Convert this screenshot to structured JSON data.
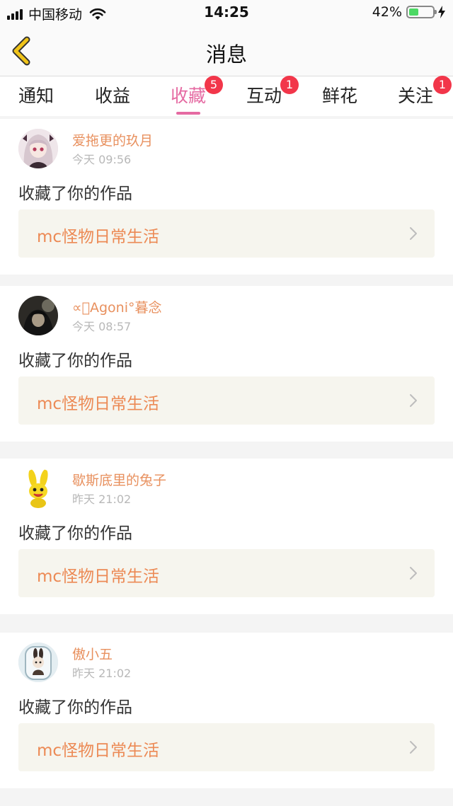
{
  "status_bar": {
    "carrier": "中国移动",
    "time": "14:25",
    "battery_percent": "42%",
    "battery_level": 0.42,
    "icons": [
      "signal-icon",
      "wifi-icon",
      "battery-icon",
      "charging-bolt-icon"
    ]
  },
  "nav": {
    "title": "消息",
    "back_icon": "chevron-left-icon",
    "accent_color": "#f0c419"
  },
  "tabs": [
    {
      "label": "通知",
      "badge": ""
    },
    {
      "label": "收益",
      "badge": ""
    },
    {
      "label": "收藏",
      "badge": "5"
    },
    {
      "label": "互动",
      "badge": "1"
    },
    {
      "label": "鲜花",
      "badge": ""
    },
    {
      "label": "关注",
      "badge": "1"
    }
  ],
  "active_tab": "收藏",
  "colors": {
    "active_tab": "#e56aa2",
    "badge": "#f2364a",
    "username": "#e8905e",
    "work_title": "#ec8a55"
  },
  "notifications": [
    {
      "username": "爱拖更的玖月",
      "time": "今天 09:56",
      "action": "收藏了你的作品",
      "work": "mc怪物日常生活"
    },
    {
      "username": "∝ﾟAgoni°暮念",
      "time": "今天 08:57",
      "action": "收藏了你的作品",
      "work": "mc怪物日常生活"
    },
    {
      "username": "歇斯底里的兔子",
      "time": "昨天 21:02",
      "action": "收藏了你的作品",
      "work": "mc怪物日常生活"
    },
    {
      "username": "傲小五",
      "time": "昨天 21:02",
      "action": "收藏了你的作品",
      "work": "mc怪物日常生活"
    }
  ]
}
